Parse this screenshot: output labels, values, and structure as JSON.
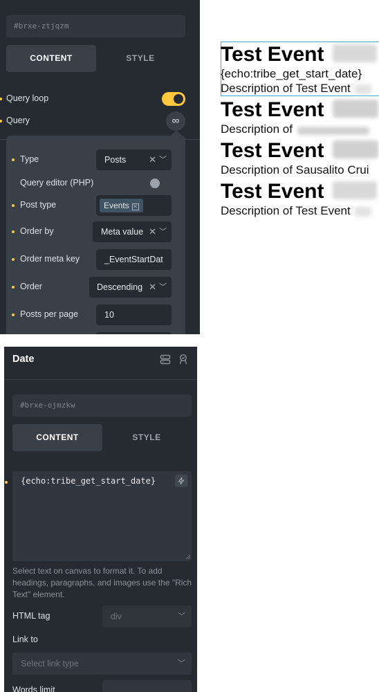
{
  "query_panel": {
    "element_id": "#brxe-ztjqzm",
    "tabs": {
      "content": "CONTENT",
      "style": "STYLE"
    },
    "query_loop_label": "Query loop",
    "query_loop_on": true,
    "query_label": "Query",
    "query_icon": "∞",
    "popup": {
      "type_label": "Type",
      "type_value": "Posts",
      "query_editor_label": "Query editor (PHP)",
      "query_editor_on": false,
      "post_type_label": "Post type",
      "post_type_chip": "Events",
      "order_by_label": "Order by",
      "order_by_value": "Meta value",
      "order_meta_key_label": "Order meta key",
      "order_meta_key_value": "_EventStartDat",
      "order_label": "Order",
      "order_value": "Descending",
      "posts_per_page_label": "Posts per page",
      "posts_per_page_value": "10"
    }
  },
  "canvas": {
    "items": [
      {
        "title": "Test Event",
        "line": "Description of Test Event"
      },
      {
        "title": "Test Event",
        "line": "Description of"
      },
      {
        "title": "Test Event",
        "line": "Description of Sausalito Crui"
      },
      {
        "title": "Test Event",
        "line": "Description of Test Event"
      }
    ],
    "date_tag": "{echo:tribe_get_start_date}"
  },
  "date_panel": {
    "title": "Date",
    "element_id": "#brxe-ojmzkw",
    "tabs": {
      "content": "CONTENT",
      "style": "STYLE"
    },
    "text_value": "{echo:tribe_get_start_date}",
    "help_text": "Select text on canvas to format it. To add headings, paragraphs, and images use the \"Rich Text\" element.",
    "html_tag_label": "HTML tag",
    "html_tag_value": "div",
    "link_to_label": "Link to",
    "link_to_placeholder": "Select link type",
    "words_limit_label": "Words limit"
  },
  "colors": {
    "panel_bg": "#262b31",
    "field_bg": "#31373e",
    "accent": "#ffc83d",
    "selection": "#3fa7c6"
  }
}
